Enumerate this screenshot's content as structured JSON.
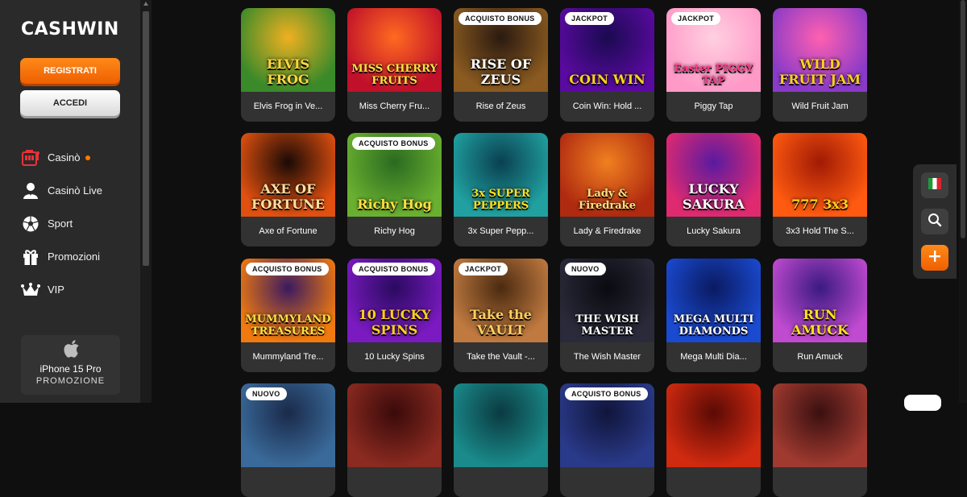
{
  "brand": {
    "logo": "CASHWIN"
  },
  "auth": {
    "register_label": "REGISTRATI",
    "login_label": "ACCEDI"
  },
  "nav": [
    {
      "label": "Casinò",
      "icon": "slot-machine-icon",
      "has_dot": true
    },
    {
      "label": "Casinò Live",
      "icon": "dealer-icon",
      "has_dot": false
    },
    {
      "label": "Sport",
      "icon": "soccer-ball-icon",
      "has_dot": false
    },
    {
      "label": "Promozioni",
      "icon": "gift-icon",
      "has_dot": false
    },
    {
      "label": "VIP",
      "icon": "crown-icon",
      "has_dot": false
    }
  ],
  "promo": {
    "icon": "apple-icon",
    "line1": "iPhone 15 Pro",
    "line2": "PROMOZIONE"
  },
  "games": [
    {
      "name": "Elvis Frog in Ve...",
      "badge": "",
      "art": "ELVIS FROG",
      "bg1": "#3a8a2a",
      "bg2": "#f0b020",
      "ink": "#ffd640"
    },
    {
      "name": "Miss Cherry Fru...",
      "badge": "",
      "art": "MISS CHERRY FRUITS",
      "bg1": "#c0102a",
      "bg2": "#ff6a20",
      "ink": "#ffe040"
    },
    {
      "name": "Rise of Zeus",
      "badge": "ACQUISTO BONUS",
      "art": "RISE OF ZEUS",
      "bg1": "#8a5a20",
      "bg2": "#2a1a10",
      "ink": "#ffffff"
    },
    {
      "name": "Coin Win: Hold ...",
      "badge": "JACKPOT",
      "art": "COIN WIN",
      "bg1": "#5a0aa0",
      "bg2": "#1a0a50",
      "ink": "#ffd020"
    },
    {
      "name": "Piggy Tap",
      "badge": "JACKPOT",
      "art": "Easter PIGGY TAP",
      "bg1": "#ff9ac8",
      "bg2": "#ffd0e0",
      "ink": "#ff3a8a"
    },
    {
      "name": "Wild Fruit Jam",
      "badge": "",
      "art": "WILD FRUIT JAM",
      "bg1": "#8a3ac8",
      "bg2": "#ff60b0",
      "ink": "#ffd020"
    },
    {
      "name": "Axe of Fortune",
      "badge": "",
      "art": "AXE OF FORTUNE",
      "bg1": "#e05010",
      "bg2": "#1a0a05",
      "ink": "#ffe0a0"
    },
    {
      "name": "Richy Hog",
      "badge": "ACQUISTO BONUS",
      "art": "Richy Hog",
      "bg1": "#6ab030",
      "bg2": "#2a6a20",
      "ink": "#ffe040"
    },
    {
      "name": "3x Super Pepp...",
      "badge": "",
      "art": "3x SUPER PEPPERS",
      "bg1": "#20a0a0",
      "bg2": "#0a4050",
      "ink": "#ffe020"
    },
    {
      "name": "Lady & Firedrake",
      "badge": "",
      "art": "Lady & Firedrake",
      "bg1": "#b02a10",
      "bg2": "#f08020",
      "ink": "#ffe080"
    },
    {
      "name": "Lucky Sakura",
      "badge": "",
      "art": "LUCKY SAKURA",
      "bg1": "#e02a70",
      "bg2": "#5a1aa0",
      "ink": "#ffffff"
    },
    {
      "name": "3x3 Hold The S...",
      "badge": "",
      "art": "777 3x3",
      "bg1": "#ff5a10",
      "bg2": "#a01a05",
      "ink": "#ffd020"
    },
    {
      "name": "Mummyland Tre...",
      "badge": "ACQUISTO BONUS",
      "art": "MUMMYLAND TREASURES",
      "bg1": "#f07a10",
      "bg2": "#3a1a60",
      "ink": "#ffe040"
    },
    {
      "name": "10 Lucky Spins",
      "badge": "ACQUISTO BONUS",
      "art": "10 LUCKY SPINS",
      "bg1": "#7a1ac0",
      "bg2": "#2a0a60",
      "ink": "#ffd020"
    },
    {
      "name": "Take the Vault -...",
      "badge": "JACKPOT",
      "art": "Take the VAULT",
      "bg1": "#c07a40",
      "bg2": "#4a2a10",
      "ink": "#ffd060"
    },
    {
      "name": "The Wish Master",
      "badge": "NUOVO",
      "art": "THE WISH MASTER",
      "bg1": "#2a2a3a",
      "bg2": "#0a0a10",
      "ink": "#ffffff"
    },
    {
      "name": "Mega Multi Dia...",
      "badge": "",
      "art": "MEGA MULTI DIAMONDS",
      "bg1": "#1a4ad0",
      "bg2": "#0a1a60",
      "ink": "#ffffff"
    },
    {
      "name": "Run Amuck",
      "badge": "",
      "art": "RUN AMUCK",
      "bg1": "#c04ad0",
      "bg2": "#3a1a80",
      "ink": "#ffe020"
    },
    {
      "name": "",
      "badge": "NUOVO",
      "art": "",
      "bg1": "#3a6a9a",
      "bg2": "#1a2a4a",
      "ink": "#ffffff"
    },
    {
      "name": "",
      "badge": "",
      "art": "",
      "bg1": "#8a2a20",
      "bg2": "#3a0a0a",
      "ink": "#ffffff"
    },
    {
      "name": "",
      "badge": "",
      "art": "",
      "bg1": "#1a8a8a",
      "bg2": "#0a3a40",
      "ink": "#ffffff"
    },
    {
      "name": "",
      "badge": "ACQUISTO BONUS",
      "art": "",
      "bg1": "#2a3a8a",
      "bg2": "#10153a",
      "ink": "#ffffff"
    },
    {
      "name": "",
      "badge": "",
      "art": "",
      "bg1": "#d02a10",
      "bg2": "#5a0a05",
      "ink": "#ffffff"
    },
    {
      "name": "",
      "badge": "",
      "art": "",
      "bg1": "#a03a30",
      "bg2": "#3a1010",
      "ink": "#ffffff"
    }
  ],
  "side_actions": [
    {
      "icon": "italy-flag-icon"
    },
    {
      "icon": "search-icon"
    },
    {
      "icon": "plus-icon"
    }
  ]
}
